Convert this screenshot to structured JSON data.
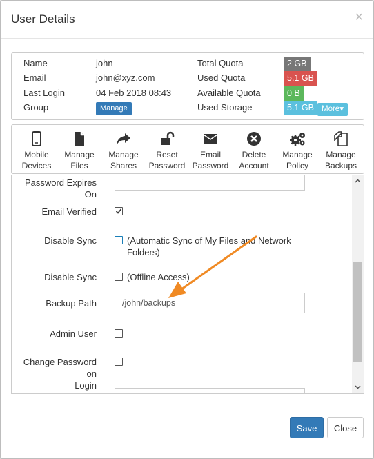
{
  "modal": {
    "title": "User Details",
    "close_glyph": "×"
  },
  "info": {
    "rows": [
      {
        "label": "Name",
        "value": "john",
        "quota_label": "Total Quota",
        "quota_value": "2 GB",
        "quota_color": "#777777"
      },
      {
        "label": "Email",
        "value": "john@xyz.com",
        "quota_label": "Used Quota",
        "quota_value": "5.1 GB",
        "quota_color": "#d9534f"
      },
      {
        "label": "Last Login",
        "value": "04 Feb 2018 08:43",
        "quota_label": "Available Quota",
        "quota_value": "0 B",
        "quota_color": "#5cb85c"
      },
      {
        "label": "Group",
        "value": "",
        "quota_label": "Used Storage",
        "quota_value": "5.1 GB",
        "quota_color": "#5bc0de"
      }
    ],
    "group_button": "Manage",
    "more_button": "More▾"
  },
  "toolbar": {
    "items": [
      {
        "line1": "Mobile",
        "line2": "Devices",
        "icon": "mobile-icon"
      },
      {
        "line1": "Manage",
        "line2": "Files",
        "icon": "file-icon"
      },
      {
        "line1": "Manage",
        "line2": "Shares",
        "icon": "share-icon"
      },
      {
        "line1": "Reset",
        "line2": "Password",
        "icon": "unlock-icon"
      },
      {
        "line1": "Email",
        "line2": "Password",
        "icon": "envelope-icon"
      },
      {
        "line1": "Delete",
        "line2": "Account",
        "icon": "delete-icon"
      },
      {
        "line1": "Manage",
        "line2": "Policy",
        "icon": "gears-icon"
      },
      {
        "line1": "Manage",
        "line2": "Backups",
        "icon": "copy-icon"
      }
    ]
  },
  "form": {
    "password_expires_label": "Password Expires On",
    "password_expires_value": "",
    "email_verified_label": "Email Verified",
    "disable_sync_label": "Disable Sync",
    "disable_sync_text_1": "(Automatic Sync of My Files and Network",
    "disable_sync_text_2": "Folders)",
    "disable_sync2_label": "Disable Sync",
    "disable_sync2_text": "(Offline Access)",
    "backup_path_label": "Backup Path",
    "backup_path_value": "/john/backups",
    "admin_user_label": "Admin User",
    "change_password_label_1": "Change Password on",
    "change_password_label_2": "Login"
  },
  "footer": {
    "save": "Save",
    "close": "Close"
  },
  "colors": {
    "primary": "#337ab7",
    "info": "#5bc0de",
    "annotation_arrow": "#f08a24"
  }
}
